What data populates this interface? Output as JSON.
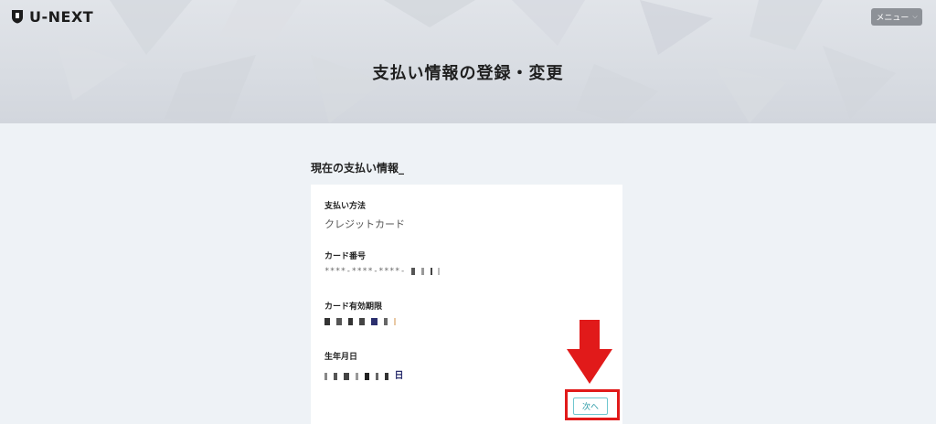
{
  "header": {
    "logo_text": "U-NEXT",
    "menu_label": "メニュー"
  },
  "page_title": "支払い情報の登録・変更",
  "section_title": "現在の支払い情報_",
  "fields": {
    "payment_method": {
      "label": "支払い方法",
      "value": "クレジットカード"
    },
    "card_number": {
      "label": "カード番号",
      "value": "****-****-****-"
    },
    "card_expiry": {
      "label": "カード有効期限"
    },
    "birth_date": {
      "label": "生年月日",
      "suffix": "日"
    }
  },
  "next_button": {
    "label": "次へ"
  },
  "colors": {
    "annotation_red": "#e11a1a",
    "next_button_teal": "#2a9aa6",
    "menu_gray": "#8d9197"
  },
  "icons": {
    "logo": "u-next-shield-icon",
    "menu_chevron": "chevron-down-icon",
    "annotation": "down-arrow-icon"
  }
}
